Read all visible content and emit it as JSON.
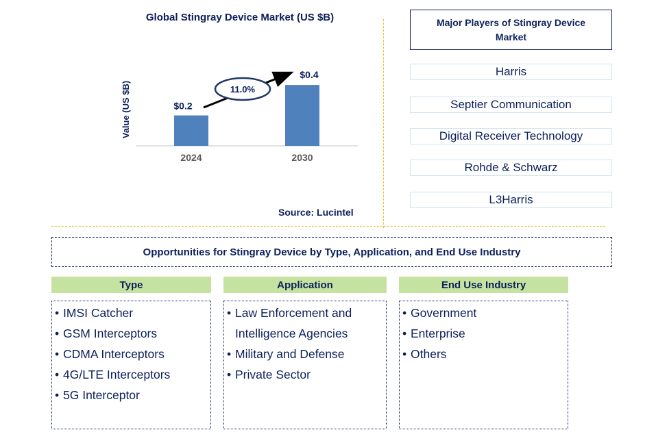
{
  "chart_data": {
    "type": "bar",
    "title": "Global Stingray Device Market (US $B)",
    "xlabel": "",
    "ylabel": "Value (US $B)",
    "categories": [
      "2024",
      "2030"
    ],
    "values": [
      0.2,
      0.4
    ],
    "data_labels": [
      "$0.2",
      "$0.4"
    ],
    "ylim": [
      0,
      0.45
    ],
    "grid": false,
    "bar_color": "#4f81bd",
    "annotation": {
      "type": "cagr-arrow",
      "label": "11.0%"
    }
  },
  "source": "Source: Lucintel",
  "players": {
    "title": "Major Players of Stingray Device Market",
    "items": [
      "Harris",
      "Septier Communication",
      "Digital Receiver Technology",
      "Rohde & Schwarz",
      "L3Harris"
    ]
  },
  "opportunities": {
    "title": "Opportunities for Stingray Device by Type, Application, and End Use Industry",
    "categories": [
      {
        "header": "Type",
        "items": [
          [
            "IMSI Catcher"
          ],
          [
            "GSM Interceptors"
          ],
          [
            "CDMA Interceptors"
          ],
          [
            "4G/LTE Interceptors"
          ],
          [
            "5G Interceptor"
          ]
        ]
      },
      {
        "header": "Application",
        "items": [
          [
            "Law Enforcement and",
            "Intelligence Agencies"
          ],
          [
            "Military and Defense"
          ],
          [
            "Private Sector"
          ]
        ]
      },
      {
        "header": "End Use Industry",
        "items": [
          [
            "Government"
          ],
          [
            "Enterprise"
          ],
          [
            "Others"
          ]
        ]
      }
    ]
  },
  "colors": {
    "text": "#0c1f5a",
    "bar": "#4f81bd",
    "category_header": "#c6e2a0",
    "divider": "#f2bd1d"
  }
}
